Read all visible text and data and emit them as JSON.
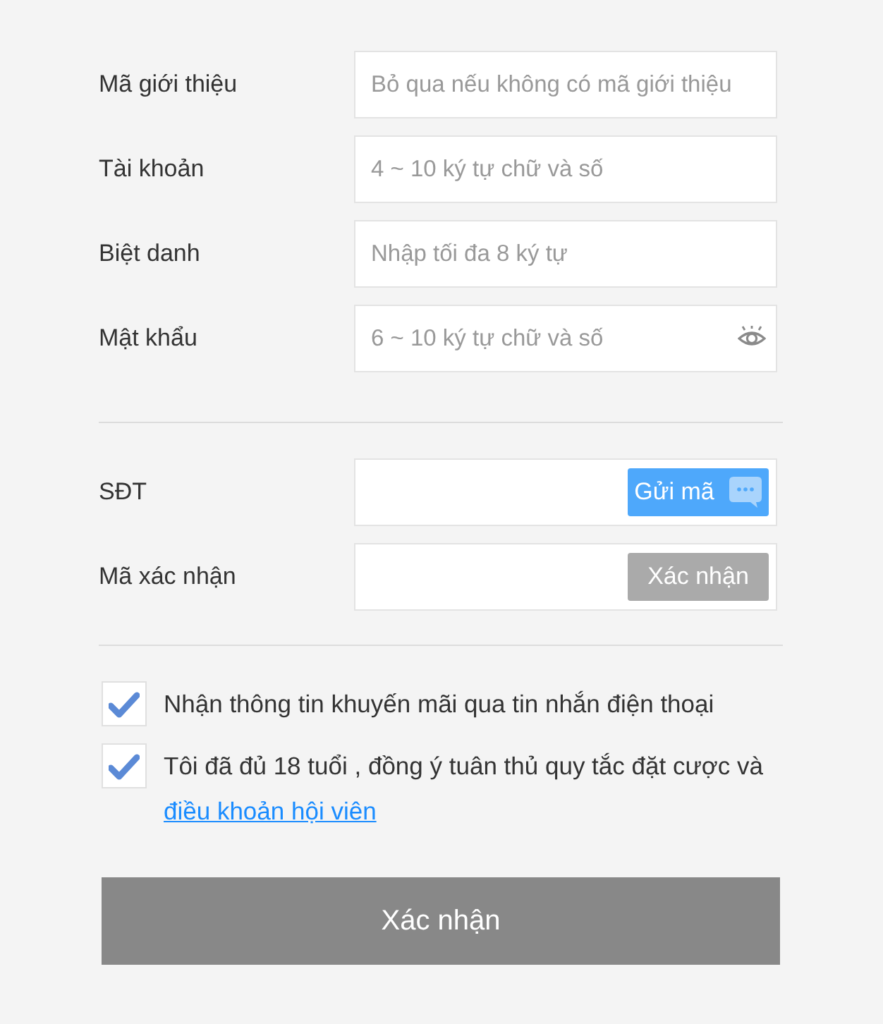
{
  "fields": [
    {
      "label": "Mã giới thiệu",
      "placeholder": "Bỏ qua nếu không có mã giới thiệu",
      "kind": "text"
    },
    {
      "label": "Tài khoản",
      "placeholder": "4 ~ 10 ký tự chữ và số",
      "kind": "text"
    },
    {
      "label": "Biệt danh",
      "placeholder": "Nhập tối đa 8 ký tự",
      "kind": "text"
    },
    {
      "label": "Mật khẩu",
      "placeholder": "6 ~ 10 ký tự chữ và số",
      "kind": "password"
    }
  ],
  "verification": [
    {
      "label": "SĐT",
      "button": "Gửi mã",
      "kind": "send_code",
      "disabled": false
    },
    {
      "label": "Mã xác nhận",
      "button": "Xác nhận",
      "kind": "confirm",
      "disabled": true
    }
  ],
  "agreements": [
    {
      "text": "Nhận thông tin khuyến mãi qua tin nhắn điện thoại",
      "checked": true
    },
    {
      "text": "Tôi đã đủ 18 tuổi , đồng ý tuân thủ quy tắc đặt cược và",
      "link": "điều khoản hội viên",
      "checked": true
    }
  ],
  "submit": {
    "label": "Xác nhận"
  }
}
